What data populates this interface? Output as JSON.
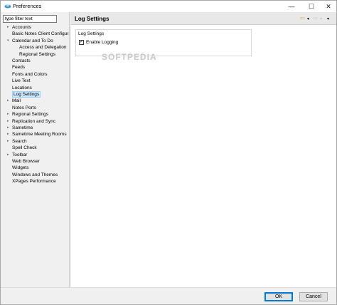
{
  "window": {
    "title": "Preferences",
    "minimize": "—",
    "maximize": "☐",
    "close": "✕"
  },
  "filter": {
    "placeholder": "type filter text"
  },
  "tree": [
    {
      "label": "Accounts",
      "level": 0,
      "expandable": true
    },
    {
      "label": "Basic Notes Client Configura",
      "level": 0,
      "expandable": false
    },
    {
      "label": "Calendar and To Do",
      "level": 0,
      "expandable": true,
      "expanded": true
    },
    {
      "label": "Access and Delegation",
      "level": 1,
      "expandable": false
    },
    {
      "label": "Regional Settings",
      "level": 1,
      "expandable": false
    },
    {
      "label": "Contacts",
      "level": 0,
      "expandable": false
    },
    {
      "label": "Feeds",
      "level": 0,
      "expandable": false
    },
    {
      "label": "Fonts and Colors",
      "level": 0,
      "expandable": false
    },
    {
      "label": "Live Text",
      "level": 0,
      "expandable": false
    },
    {
      "label": "Locations",
      "level": 0,
      "expandable": false
    },
    {
      "label": "Log Settings",
      "level": 0,
      "expandable": false,
      "selected": true
    },
    {
      "label": "Mail",
      "level": 0,
      "expandable": true
    },
    {
      "label": "Notes Ports",
      "level": 0,
      "expandable": false
    },
    {
      "label": "Regional Settings",
      "level": 0,
      "expandable": true
    },
    {
      "label": "Replication and Sync",
      "level": 0,
      "expandable": true
    },
    {
      "label": "Sametime",
      "level": 0,
      "expandable": true
    },
    {
      "label": "Sametime Meeting Rooms",
      "level": 0,
      "expandable": true
    },
    {
      "label": "Search",
      "level": 0,
      "expandable": true
    },
    {
      "label": "Spell Check",
      "level": 0,
      "expandable": false
    },
    {
      "label": "Toolbar",
      "level": 0,
      "expandable": true
    },
    {
      "label": "Web Browser",
      "level": 0,
      "expandable": false
    },
    {
      "label": "Widgets",
      "level": 0,
      "expandable": false
    },
    {
      "label": "Windows and Themes",
      "level": 0,
      "expandable": false
    },
    {
      "label": "XPages Performance",
      "level": 0,
      "expandable": false
    }
  ],
  "page": {
    "title": "Log Settings",
    "group_label": "Log Settings",
    "checkbox_label": "Enable Logging",
    "checkbox_checked": "✓",
    "watermark": "SOFTPEDIA"
  },
  "nav_icons": {
    "back": "⇦",
    "back_menu": "▾",
    "forward": "⇨",
    "forward_menu": "▾",
    "more": "▾"
  },
  "buttons": {
    "ok": "OK",
    "cancel": "Cancel"
  },
  "colors": {
    "selection": "#cce8ff",
    "back_arrow": "#e8a33d",
    "ok_border": "#0078d7"
  }
}
